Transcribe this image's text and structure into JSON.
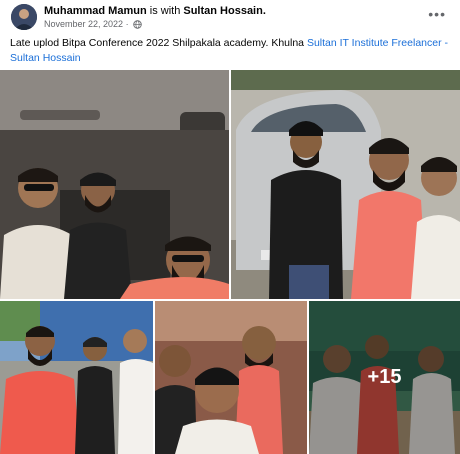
{
  "post": {
    "author": "Muhammad Mamun",
    "with_text": "is with",
    "tagged_person": "Sultan Hossain",
    "date": "November 22, 2022",
    "privacy_icon": "globe-icon",
    "more_icon": "more-options-icon",
    "caption_text": "Late uplod Bitpa Conference 2022 Shilpakala academy.  Khulna",
    "caption_links": [
      "Sultan IT Institute",
      "Freelancer -",
      "Sultan Hossain"
    ],
    "more_photos_count": "+15"
  },
  "colors": {
    "link": "#1b6fd8",
    "secondary_text": "#65676b"
  }
}
